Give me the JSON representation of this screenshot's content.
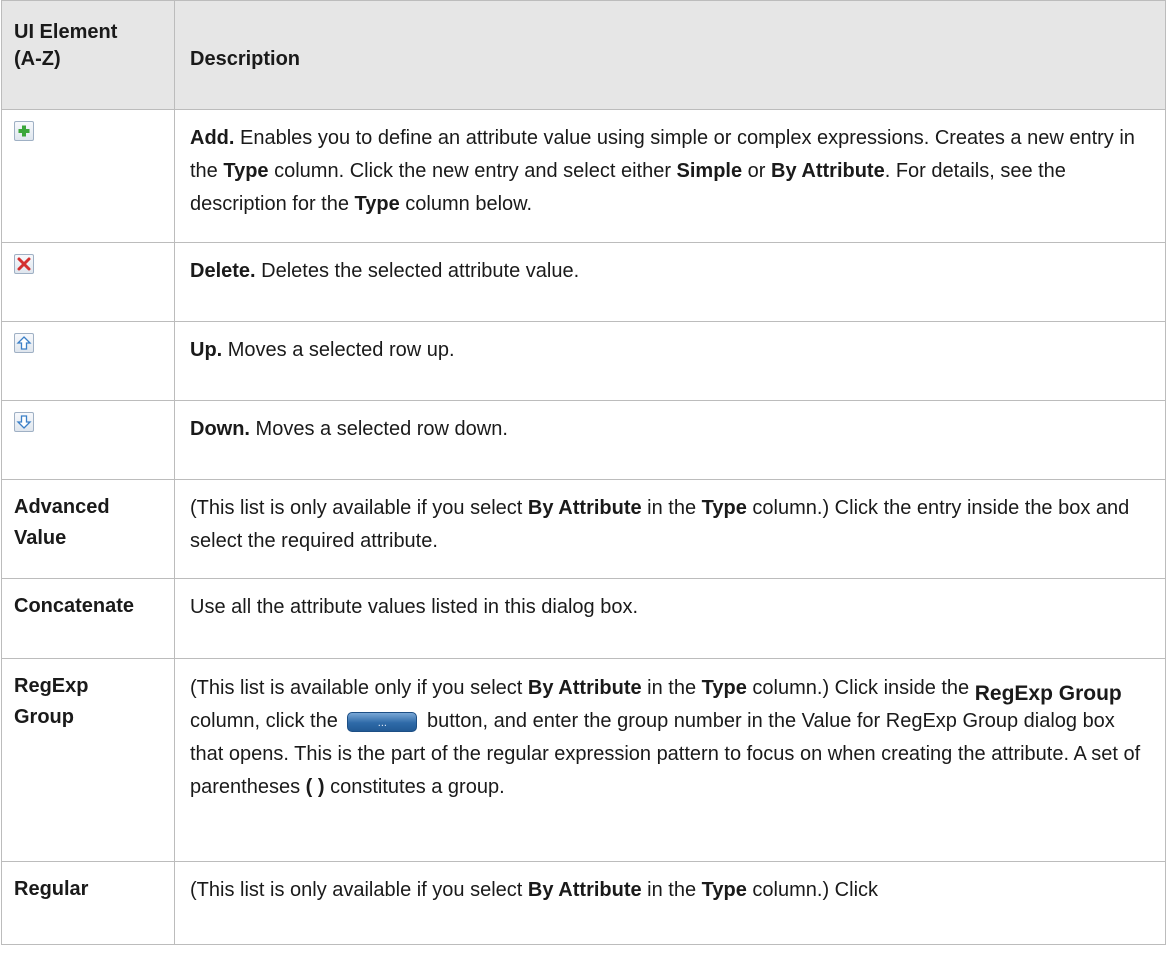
{
  "header": {
    "col1_line1": "UI Element",
    "col1_line2": "(A-Z)",
    "col2": "Description"
  },
  "icons": {
    "add": "plus-icon",
    "delete": "delete-x-icon",
    "up": "arrow-up-icon",
    "down": "arrow-down-icon",
    "colors": {
      "plus": "#3aa63a",
      "delete": "#d33030",
      "arrow": "#3b7fc7"
    }
  },
  "rows": {
    "add": {
      "title": "Add.",
      "t1": " Enables you to define an attribute value using simple or complex expressions. Creates a new entry in the ",
      "b1": "Type",
      "t2": " column. Click the new entry and select either ",
      "b2": "Simple",
      "t3": " or ",
      "b3": "By Attribute",
      "t4": ". For details, see the description for the ",
      "b4": "Type",
      "t5": " column below."
    },
    "delete": {
      "title": "Delete.",
      "t1": " Deletes the selected attribute value."
    },
    "up": {
      "title": "Up.",
      "t1": " Moves a selected row up."
    },
    "down": {
      "title": "Down.",
      "t1": " Moves a selected row down."
    },
    "advanced_value": {
      "label_line1": "Advanced",
      "label_line2": "Value",
      "t1": "(This list is only available if you select ",
      "b1": "By Attribute",
      "t2": " in the ",
      "b2": "Type",
      "t3": " column.) Click the entry inside the box and select the required attribute."
    },
    "concatenate": {
      "label": "Concatenate",
      "t1": "Use all the attribute values listed in this dialog box."
    },
    "regexp_group": {
      "label_line1": "RegExp",
      "label_line2": "Group",
      "t1": "(This list is available only if you select ",
      "b1": "By Attribute",
      "t2": " in the ",
      "b2": "Type",
      "t3": " column.) Click inside the ",
      "big": "RegExp Group",
      "t4": " column, click the ",
      "button_label": "...",
      "t5": " button, and enter the group number in the Value for RegExp Group dialog box that opens. This is the part of the regular expression pattern to focus on when creating the attribute. A set of parentheses ",
      "b3": "( )",
      "t6": " constitutes a group."
    },
    "regular": {
      "label": "Regular",
      "t1": "(This list is only available if you select ",
      "b1": "By Attribute",
      "t2": " in the ",
      "b2": "Type",
      "t3": " column.) Click"
    }
  }
}
